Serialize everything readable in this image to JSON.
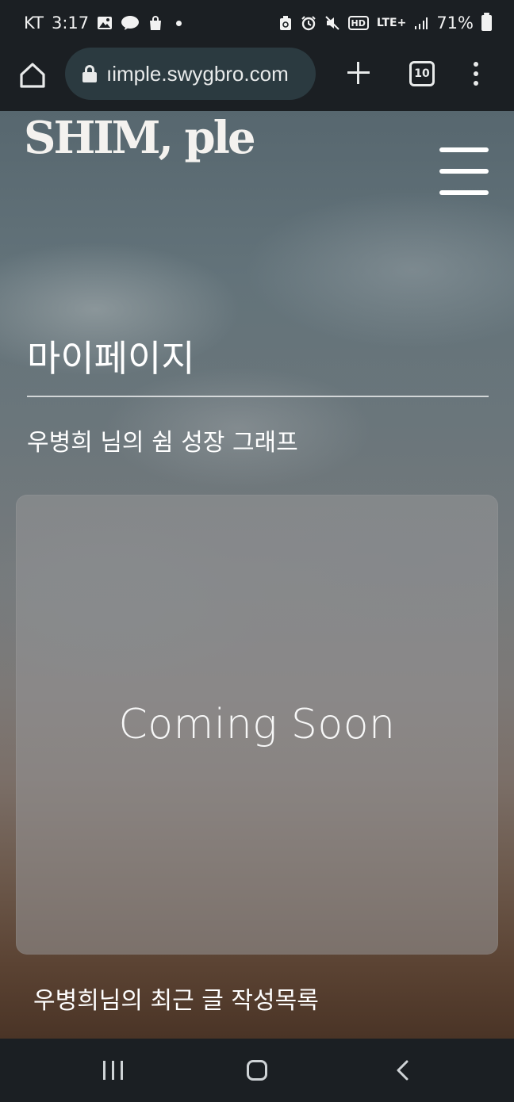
{
  "status_bar": {
    "carrier": "KT",
    "time": "3:17",
    "left_icons": [
      "gallery-icon",
      "talk-icon",
      "shopping-bag-icon",
      "notification-dot"
    ],
    "right_icons": [
      "recycle-icon",
      "alarm-icon",
      "mute-icon",
      "hd-icon",
      "lte-plus-icon",
      "signal-icon",
      "battery-icon"
    ],
    "hd_label": "HD",
    "network": "LTE+",
    "battery": "71%"
  },
  "browser": {
    "url": "ıimple.swygbro.com",
    "tab_count": "10"
  },
  "site": {
    "logo": "SHIM, ple"
  },
  "page": {
    "title": "마이페이지",
    "graph_heading": "우병희 님의 쉼 성장 그래프",
    "graph_placeholder": "Coming Soon",
    "recent_heading": "우병희님의 최근 글 작성목록"
  },
  "colors": {
    "system_bar": "#1b1f23",
    "url_pill": "#2b3a40",
    "card_overlay": "#969698"
  }
}
